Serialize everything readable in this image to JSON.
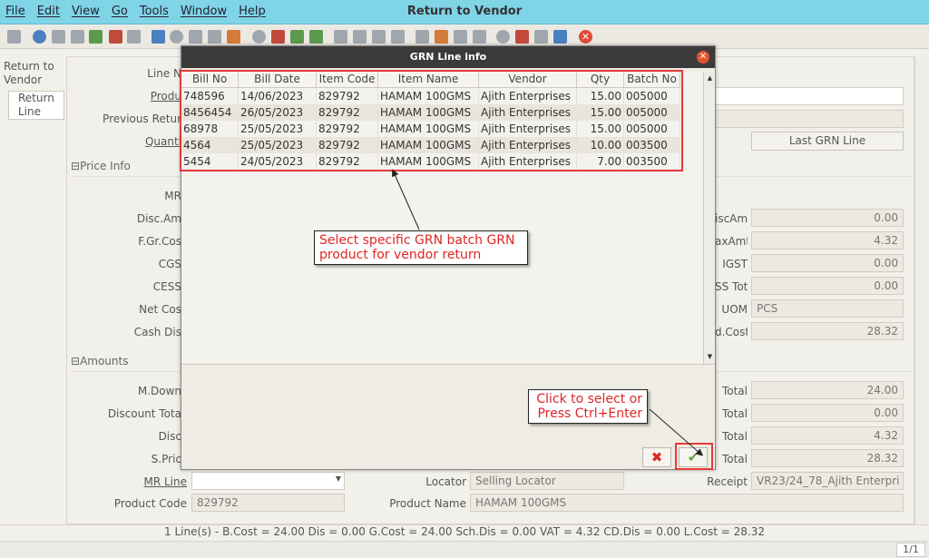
{
  "window": {
    "title": "Return to Vendor"
  },
  "menu": [
    "File",
    "Edit",
    "View",
    "Go",
    "Tools",
    "Window",
    "Help"
  ],
  "left_tabs": {
    "return_to_vendor": "Return to Vendor",
    "return_line": "Return Line"
  },
  "form": {
    "line_no_label": "Line N",
    "product_label": "Produ",
    "previous_return_label": "Previous Retur",
    "quantity_label": "Quanti",
    "last_grn_line_button": "Last GRN Line",
    "price_info_section": "Price Info",
    "mrp_label": "MR",
    "disc_amt_label": "Disc.Am",
    "fgr_cost_label": "F.Gr.Cos",
    "cgst_label": "CGS",
    "cess_label": "CESS",
    "net_cost_label": "Net Cos",
    "cash_dis_label": "Cash Dis",
    "right_disc_amt_label": "iscAmt",
    "right_tax_amt_label": "axAmt",
    "igst_label": "IGST",
    "cess_tot_label": "SS Tot",
    "uom_label": "UOM",
    "ld_cost_label": "d.Cost",
    "disc_amt_value": "0.00",
    "tax_amt_value": "4.32",
    "igst_value": "0.00",
    "cess_tot_value": "0.00",
    "uom_value": "PCS",
    "ld_cost_value": "28.32",
    "amounts_section": "Amounts",
    "mdown_label": "M.Down",
    "discount_total_label": "Discount Tota",
    "disc_label": "Disc",
    "sprice_label": "S.Pric",
    "total1_label": "Total",
    "total2_label": "Total",
    "total3_label": "Total",
    "total4_label": "Total",
    "total1_value": "24.00",
    "total2_value": "0.00",
    "total3_value": "4.32",
    "total4_value": "28.32",
    "mr_line_label": "MR Line",
    "locator_label": "Locator",
    "locator_value": "Selling Locator",
    "receipt_label": "Receipt",
    "receipt_value": "VR23/24_78_Ajith Enterpri",
    "product_code_label": "Product Code",
    "product_code_value": "829792",
    "product_name_label": "Product Name",
    "product_name_value": "HAMAM 100GMS"
  },
  "status": {
    "summary": "1 Line(s) -   B.Cost = 24.00    Dis = 0.00    G.Cost = 24.00    Sch.Dis = 0.00    VAT = 4.32    CD.Dis = 0.00    L.Cost = 28.32",
    "pager": "1/1"
  },
  "dialog": {
    "title": "GRN Line info",
    "columns": [
      "Bill No",
      "Bill Date",
      "Item Code",
      "Item Name",
      "Vendor",
      "Qty",
      "Batch No"
    ],
    "rows": [
      [
        "748596",
        "14/06/2023",
        "829792",
        "HAMAM 100GMS",
        "Ajith Enterprises",
        "15.00",
        "005000"
      ],
      [
        "8456454",
        "26/05/2023",
        "829792",
        "HAMAM 100GMS",
        "Ajith Enterprises",
        "15.00",
        "005000"
      ],
      [
        "68978",
        "25/05/2023",
        "829792",
        "HAMAM 100GMS",
        "Ajith Enterprises",
        "15.00",
        "005000"
      ],
      [
        "4564",
        "25/05/2023",
        "829792",
        "HAMAM 100GMS",
        "Ajith Enterprises",
        "10.00",
        "003500"
      ],
      [
        "5454",
        "24/05/2023",
        "829792",
        "HAMAM 100GMS",
        "Ajith Enterprises",
        "7.00",
        "003500"
      ]
    ]
  },
  "annotations": {
    "select_hint": "Select specific GRN batch GRN product for vendor return",
    "click_hint_line1": "Click to select or",
    "click_hint_line2": "Press Ctrl+Enter"
  },
  "colors": {
    "titlebar": "#7fd4e6",
    "highlight": "#e23b3b",
    "annotation_text": "#e02424"
  }
}
